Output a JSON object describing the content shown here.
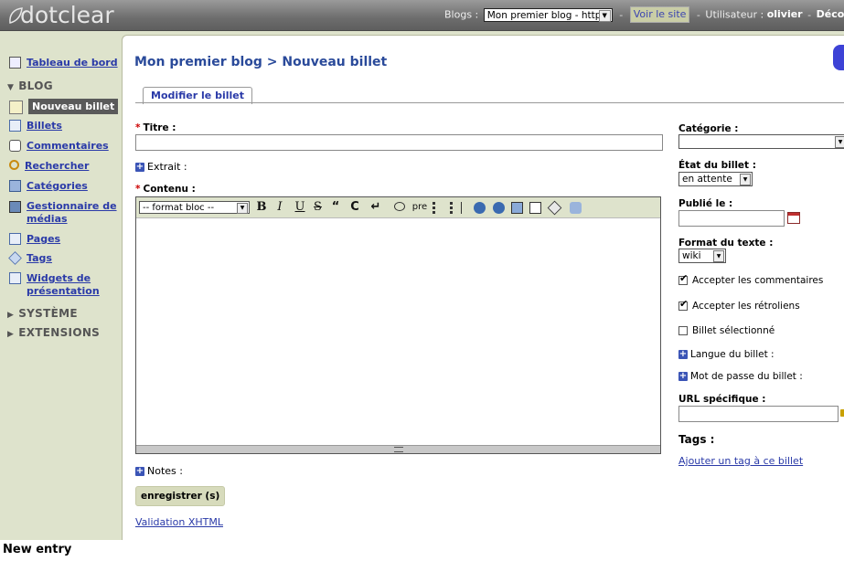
{
  "header": {
    "logo_text": "dotclear",
    "blogs_label": "Blogs :",
    "blog_selected": "Mon premier blog - http:/",
    "view_site": "Voir le site",
    "user_label": "Utilisateur :",
    "user_name": "olivier",
    "logout": "Déconnexion"
  },
  "sidebar": {
    "dashboard": "Tableau de bord",
    "blog_section": "BLOG",
    "items": [
      {
        "label": "Nouveau billet"
      },
      {
        "label": "Billets"
      },
      {
        "label": "Commentaires"
      },
      {
        "label": "Rechercher"
      },
      {
        "label": "Catégories"
      },
      {
        "label": "Gestionnaire de médias"
      },
      {
        "label": "Pages"
      },
      {
        "label": "Tags"
      },
      {
        "label": "Widgets de présentation"
      }
    ],
    "system_section": "SYSTÈME",
    "extensions_section": "EXTENSIONS"
  },
  "main": {
    "title": "Mon premier blog > Nouveau billet",
    "tab": "Modifier le billet",
    "title_label": "Titre :",
    "required_mark": "*",
    "excerpt_label": "Extrait :",
    "content_label": "Contenu :",
    "format_select": "-- format bloc --",
    "toolbar": {
      "bold": "B",
      "italic": "I",
      "underline": "U",
      "strike": "S",
      "quote": "“",
      "code": "C",
      "br": "↵",
      "pre": "pre"
    },
    "notes_label": "Notes :",
    "save_button": "enregistrer (s)",
    "validation_link": "Validation XHTML"
  },
  "side": {
    "category_label": "Catégorie :",
    "category_value": "",
    "status_label": "État du billet :",
    "status_value": "en attente",
    "published_label": "Publié le :",
    "text_format_label": "Format du texte :",
    "text_format_value": "wiki",
    "allow_comments": "Accepter les commentaires",
    "allow_trackbacks": "Accepter les rétroliens",
    "selected_entry": "Billet sélectionné",
    "language_label": "Langue du billet :",
    "password_label": "Mot de passe du billet :",
    "url_label": "URL spécifique :",
    "tags_title": "Tags :",
    "add_tag_link": "Ajouter un tag à ce billet"
  },
  "colors": {
    "accent": "#2a3aa8",
    "sidebar_bg": "#dee3cc",
    "header_bg": "#6d6d6d",
    "title_blue": "#2a4a9a"
  },
  "footer_caption": "New entry"
}
